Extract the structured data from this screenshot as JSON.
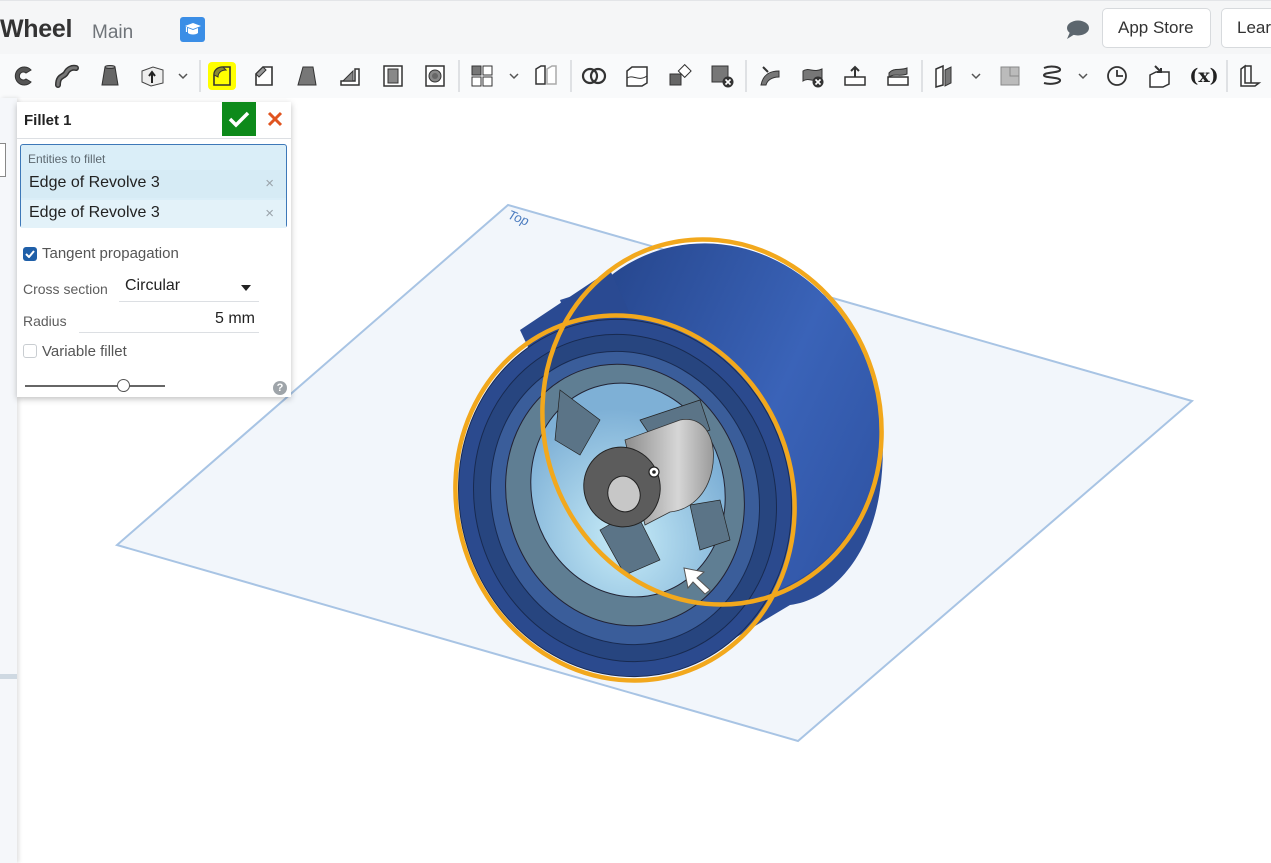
{
  "header": {
    "document_title": "Wheel",
    "branch": "Main",
    "learning_icon": "graduation-cap-icon",
    "comment_icon": "speech-bubble-icon",
    "buttons": [
      {
        "label": "App Store"
      },
      {
        "label": "Lear"
      }
    ]
  },
  "toolbar": {
    "tools": [
      {
        "name": "revolve-icon"
      },
      {
        "name": "sweep-icon"
      },
      {
        "name": "loft-icon"
      },
      {
        "name": "thicken-icon"
      },
      {
        "name": "fillet-icon",
        "active": true
      },
      {
        "name": "chamfer-icon"
      },
      {
        "name": "draft-icon"
      },
      {
        "name": "rib-icon"
      },
      {
        "name": "shell-icon"
      },
      {
        "name": "hole-icon"
      },
      {
        "name": "linear-pattern-icon"
      },
      {
        "name": "mirror-icon"
      },
      {
        "name": "boolean-icon"
      },
      {
        "name": "split-icon"
      },
      {
        "name": "transform-icon"
      },
      {
        "name": "delete-part-icon"
      },
      {
        "name": "modify-fillet-icon"
      },
      {
        "name": "delete-face-icon"
      },
      {
        "name": "move-face-icon"
      },
      {
        "name": "replace-face-icon"
      },
      {
        "name": "plane-icon"
      },
      {
        "name": "mate-connector-icon"
      },
      {
        "name": "helix-icon"
      },
      {
        "name": "rollback-icon"
      },
      {
        "name": "derived-icon"
      },
      {
        "name": "variable-icon",
        "label": "(x)"
      },
      {
        "name": "sheet-metal-icon"
      }
    ]
  },
  "feature_dialog": {
    "title": "Fillet 1",
    "confirm_icon": "checkmark-icon",
    "cancel_icon": "close-icon",
    "entities_label": "Entities to fillet",
    "entities": [
      {
        "label": "Edge of Revolve 3"
      },
      {
        "label": "Edge of Revolve 3"
      }
    ],
    "remove_glyph": "×",
    "tangent_propagation": {
      "label": "Tangent propagation",
      "checked": true
    },
    "cross_section": {
      "label": "Cross section",
      "value": "Circular"
    },
    "radius": {
      "label": "Radius",
      "value": "5 mm"
    },
    "variable_fillet": {
      "label": "Variable fillet",
      "checked": false
    },
    "slider_fraction": 0.7,
    "help_glyph": "?"
  },
  "viewport": {
    "plane_label": "Top",
    "colors": {
      "selection": "#f2a81d",
      "tire": "#2d4f9a",
      "plane_edge": "#a8c4e4",
      "plane_fill": "#f2f6fb"
    }
  }
}
